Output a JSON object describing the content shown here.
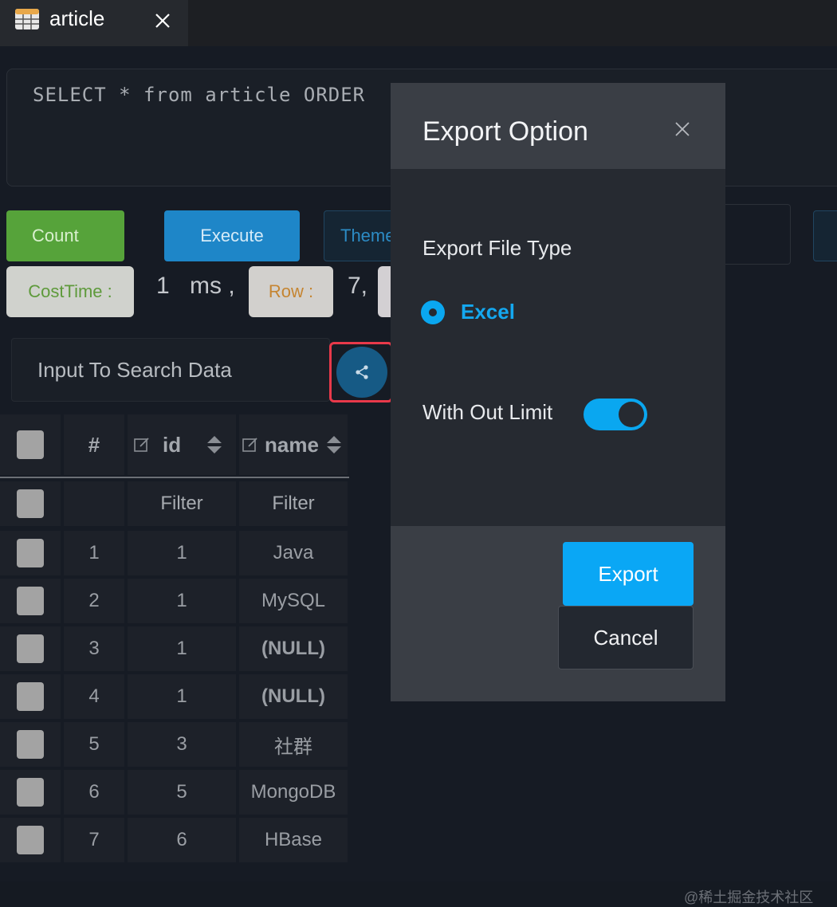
{
  "tab": {
    "title": "article",
    "icon": "table-icon"
  },
  "sql": {
    "query": "SELECT * from article ORDER"
  },
  "toolbar": {
    "count_label": "Count",
    "execute_label": "Execute",
    "theme_label": "Theme"
  },
  "stats": {
    "cost_label": "CostTime :",
    "cost_value": "1",
    "cost_unit": "ms ,",
    "row_label": "Row :",
    "row_value": "7,"
  },
  "search": {
    "placeholder": "Input To Search Data"
  },
  "table": {
    "headers": {
      "index": "#",
      "id": "id",
      "name": "name"
    },
    "filter_label": "Filter",
    "rows": [
      {
        "index": "1",
        "id": "1",
        "name": "Java",
        "null": false
      },
      {
        "index": "2",
        "id": "1",
        "name": "MySQL",
        "null": false
      },
      {
        "index": "3",
        "id": "1",
        "name": "(NULL)",
        "null": true
      },
      {
        "index": "4",
        "id": "1",
        "name": "(NULL)",
        "null": true
      },
      {
        "index": "5",
        "id": "3",
        "name": "社群",
        "null": false
      },
      {
        "index": "6",
        "id": "5",
        "name": "MongoDB",
        "null": false
      },
      {
        "index": "7",
        "id": "6",
        "name": "HBase",
        "null": false
      }
    ]
  },
  "modal": {
    "title": "Export Option",
    "file_type_label": "Export File Type",
    "file_type_option": "Excel",
    "limit_label": "With Out Limit",
    "limit_enabled": true,
    "export_label": "Export",
    "cancel_label": "Cancel"
  },
  "watermark": "@稀土掘金技术社区",
  "colors": {
    "accent": "#0aa7f0",
    "count": "#56a33a",
    "execute": "#1e86c8",
    "highlight": "#e8394a"
  }
}
